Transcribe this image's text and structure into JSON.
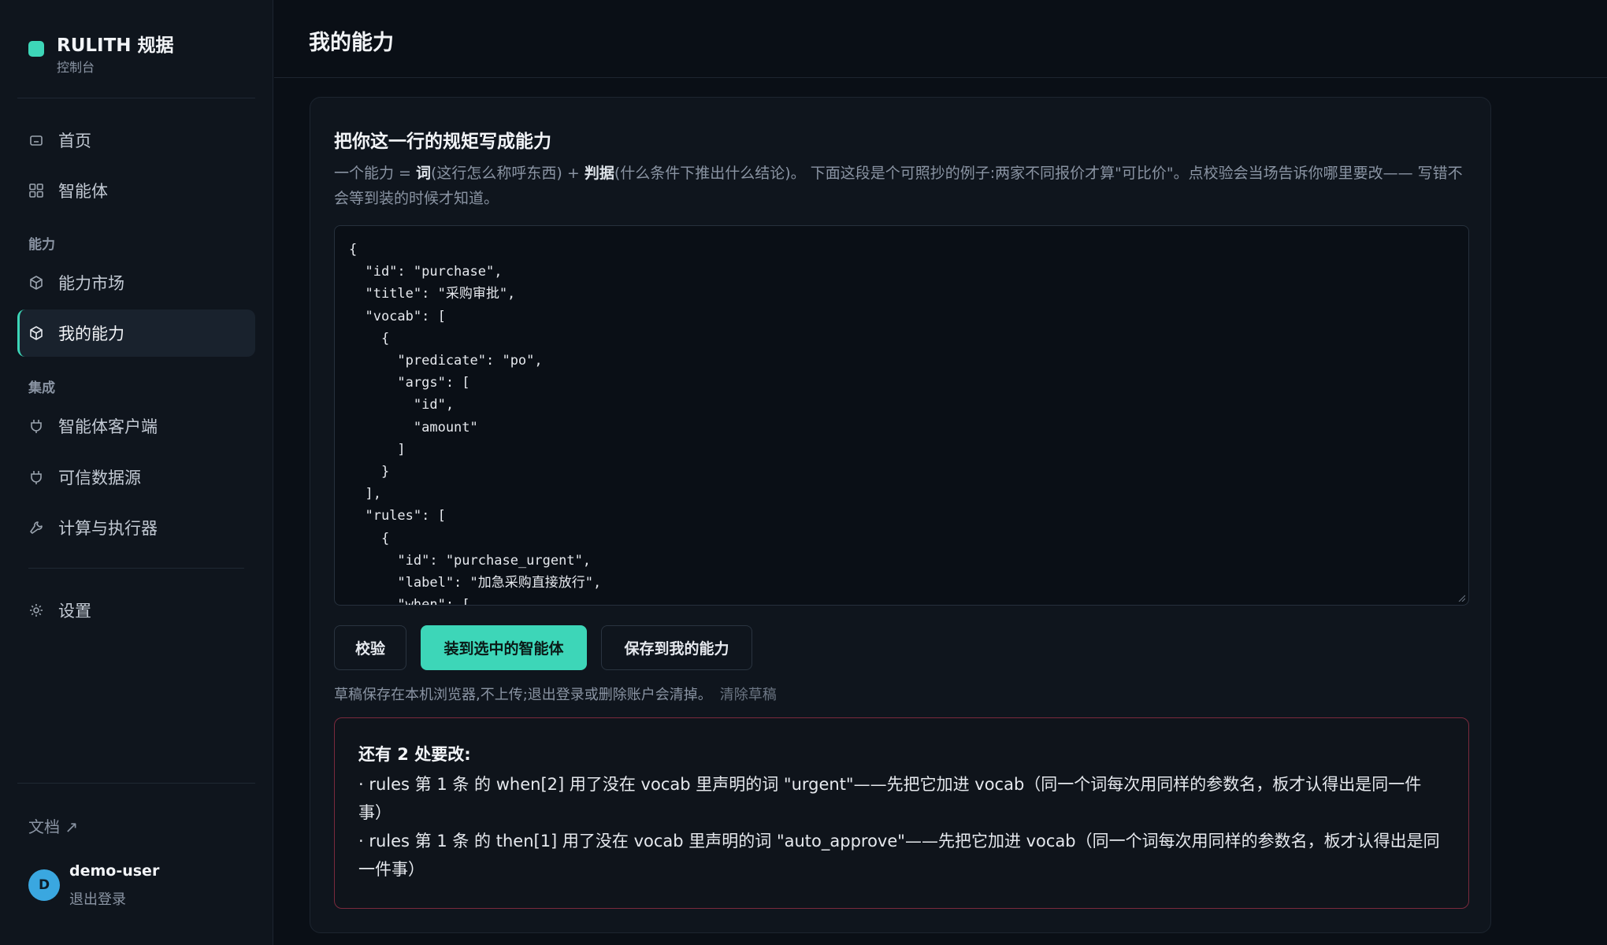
{
  "brand": {
    "title": "RULITH 规据",
    "subtitle": "控制台"
  },
  "nav": {
    "home": "首页",
    "agents": "智能体",
    "section_capability": "能力",
    "market": "能力市场",
    "my_capability": "我的能力",
    "section_integration": "集成",
    "agent_clients": "智能体客户端",
    "trusted_sources": "可信数据源",
    "compute_executors": "计算与执行器",
    "settings": "设置"
  },
  "sidebar_footer": {
    "docs": "文档 ↗",
    "avatar_letter": "D",
    "user": "demo-user",
    "logout": "退出登录"
  },
  "header": {
    "title": "我的能力"
  },
  "card": {
    "title": "把你这一行的规矩写成能力",
    "desc_1": "一个能力 = ",
    "desc_word": "词",
    "desc_2": "(这行怎么称呼东西) + ",
    "desc_judge": "判据",
    "desc_3": "(什么条件下推出什么结论)。 下面这段是个可照抄的例子:两家不同报价才算\"可比价\"。点校验会当场告诉你哪里要改—— 写错不会等到装的时候才知道。"
  },
  "editor": {
    "content": "{\n  \"id\": \"purchase\",\n  \"title\": \"采购审批\",\n  \"vocab\": [\n    {\n      \"predicate\": \"po\",\n      \"args\": [\n        \"id\",\n        \"amount\"\n      ]\n    }\n  ],\n  \"rules\": [\n    {\n      \"id\": \"purchase_urgent\",\n      \"label\": \"加急采购直接放行\",\n      \"when\": ["
  },
  "buttons": {
    "validate": "校验",
    "install": "装到选中的智能体",
    "save": "保存到我的能力"
  },
  "draft": {
    "note": "草稿保存在本机浏览器,不上传;退出登录或删除账户会清掉。",
    "clear": "清除草稿"
  },
  "errors": {
    "title": "还有 2 处要改:",
    "items": [
      "· rules 第 1 条 的 when[2] 用了没在 vocab 里声明的词 \"urgent\"——先把它加进 vocab（同一个词每次用同样的参数名，板才认得出是同一件事）",
      "· rules 第 1 条 的 then[1] 用了没在 vocab 里声明的词 \"auto_approve\"——先把它加进 vocab（同一个词每次用同样的参数名，板才认得出是同一件事）"
    ]
  },
  "colors": {
    "accent": "#3dd6b8",
    "background": "#0a0f16",
    "panel": "#0f151d",
    "error_border": "#7a2a3d"
  }
}
